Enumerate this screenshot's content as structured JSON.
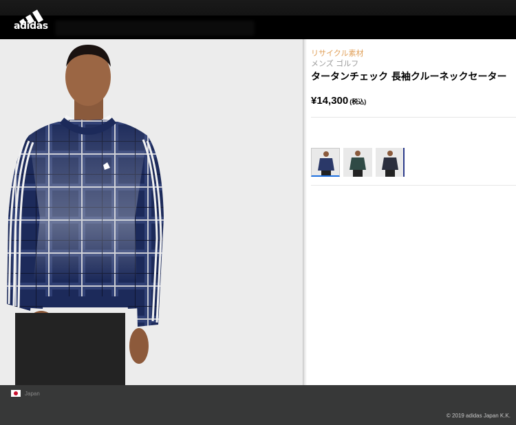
{
  "header": {
    "brand": "adidas"
  },
  "product": {
    "tag_recycle": "リサイクル素材",
    "category": "メンズ ゴルフ",
    "title": "タータンチェック 長袖クルーネックセーター",
    "price": "¥14,300",
    "price_tax_note": "(税込)",
    "colors": {
      "recycle_tag": "#e0a05a",
      "selected_thumb_indicator": "#1c6fe0",
      "sweater_navy": "#1c2a5a"
    },
    "thumbnails": [
      {
        "name": "navy-plaid",
        "selected": true
      },
      {
        "name": "green-plaid",
        "selected": false
      },
      {
        "name": "dark-plaid",
        "selected": false
      }
    ]
  },
  "footer": {
    "country": "Japan",
    "copyright": "© 2019 adidas Japan K.K."
  }
}
